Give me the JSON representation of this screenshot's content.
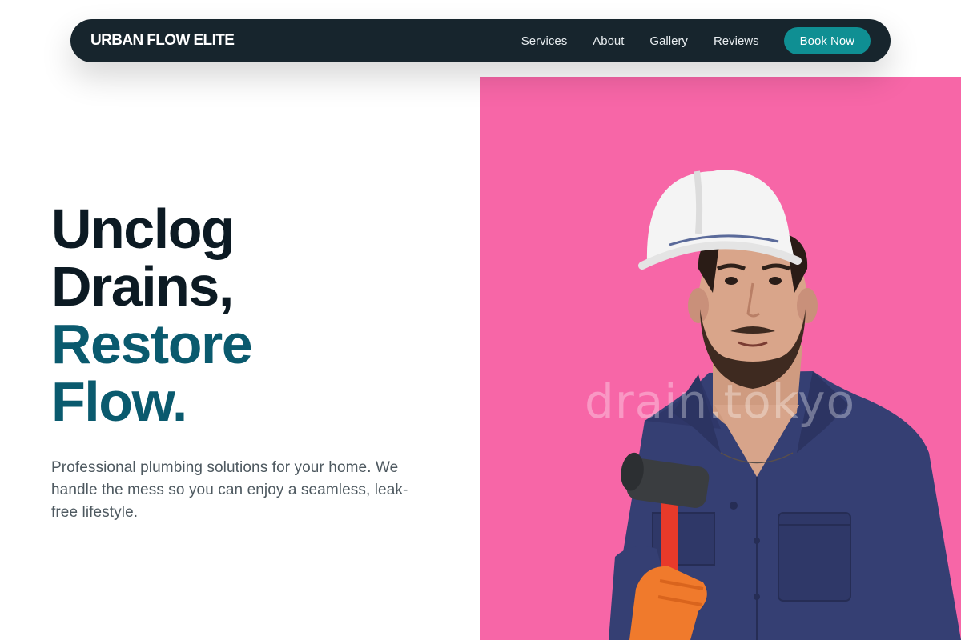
{
  "nav": {
    "brand": "URBAN FLOW ELITE",
    "links": [
      "Services",
      "About",
      "Gallery",
      "Reviews"
    ],
    "cta": "Book Now"
  },
  "hero": {
    "headline_dark": [
      "Unclog",
      "Drains,"
    ],
    "headline_accent": [
      "Restore",
      "Flow."
    ],
    "subtext": "Professional plumbing solutions for your home. We handle the mess so you can enjoy a seamless, leak-free lifestyle.",
    "image": {
      "subject": "plumber-with-hard-hat-and-mallet",
      "background_color": "#f766a7",
      "watermark": "drain.tokyo"
    }
  },
  "colors": {
    "nav_bg": "#17252d",
    "accent": "#0f8f93",
    "headline_dark": "#0c1a23",
    "headline_accent": "#0a5a6e",
    "body_text": "#4e5960"
  }
}
